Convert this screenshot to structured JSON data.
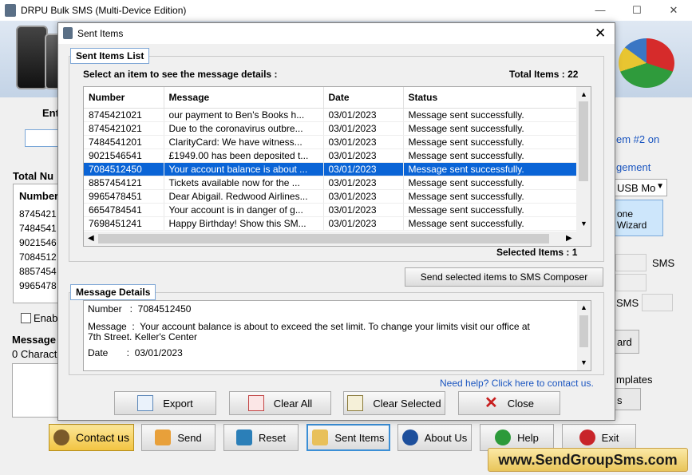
{
  "main": {
    "title": "DRPU Bulk SMS (Multi-Device Edition)",
    "enter_label": "Ent",
    "total_label": "Total Nu",
    "number_header": "Number",
    "numbers": [
      "8745421",
      "7484541",
      "9021546",
      "7084512",
      "8857454",
      "9965478"
    ],
    "enable_label": "Enab",
    "message_label": "Message",
    "chars_label": "0 Characte",
    "right_link1": "em #2 on",
    "right_link2": "gement",
    "usb_select": "USB Mo",
    "wizard_line1": "one",
    "wizard_line2": "Wizard",
    "sms_label1": "SMS",
    "sms_label2": "SMS",
    "ard_label": "ard",
    "templates_label": "mplates",
    "s_label": "s"
  },
  "bottom_buttons": {
    "contact_us": "Contact us",
    "send": "Send",
    "reset": "Reset",
    "sent_items": "Sent Items",
    "about_us": "About Us",
    "help": "Help",
    "exit": "Exit"
  },
  "watermark": "www.SendGroupSms.com",
  "dialog": {
    "title": "Sent Items",
    "list_group": "Sent Items List",
    "instruction": "Select an item to see the message details :",
    "total_items_label": "Total Items : 22",
    "columns": [
      "Number",
      "Message",
      "Date",
      "Status"
    ],
    "rows": [
      [
        "8745421021",
        "our payment to Ben's Books h...",
        "03/01/2023",
        "Message sent successfully."
      ],
      [
        "8745421021",
        "Due to the coronavirus outbre...",
        "03/01/2023",
        "Message sent successfully."
      ],
      [
        "7484541201",
        "ClarityCard: We have witness...",
        "03/01/2023",
        "Message sent successfully."
      ],
      [
        "9021546541",
        "£1949.00 has been deposited t...",
        "03/01/2023",
        "Message sent successfully."
      ],
      [
        "7084512450",
        "Your account balance is about ...",
        "03/01/2023",
        "Message sent successfully."
      ],
      [
        "8857454121",
        "Tickets available now for the ...",
        "03/01/2023",
        "Message sent successfully."
      ],
      [
        "9965478451",
        "Dear Abigail. Redwood Airlines...",
        "03/01/2023",
        "Message sent successfully."
      ],
      [
        "6654784541",
        "Your account is in danger of g...",
        "03/01/2023",
        "Message sent successfully."
      ],
      [
        "7698451241",
        "Happy Birthday! Show this SM...",
        "03/01/2023",
        "Message sent successfully."
      ]
    ],
    "selected_index": 4,
    "selected_items_label": "Selected Items : 1",
    "send_to_composer": "Send selected items to SMS Composer",
    "details_group": "Message Details",
    "detail_number": "Number   :  7084512450",
    "detail_message_1": "Message  :  Your account balance is about to exceed the set limit. To change your limits visit our office at",
    "detail_message_2": "7th Street. Keller's Center",
    "detail_date": "Date       :  03/01/2023",
    "help_link": "Need help? Click here to contact us.",
    "buttons": {
      "export": "Export",
      "clear_all": "Clear All",
      "clear_selected": "Clear Selected",
      "close": "Close"
    }
  }
}
